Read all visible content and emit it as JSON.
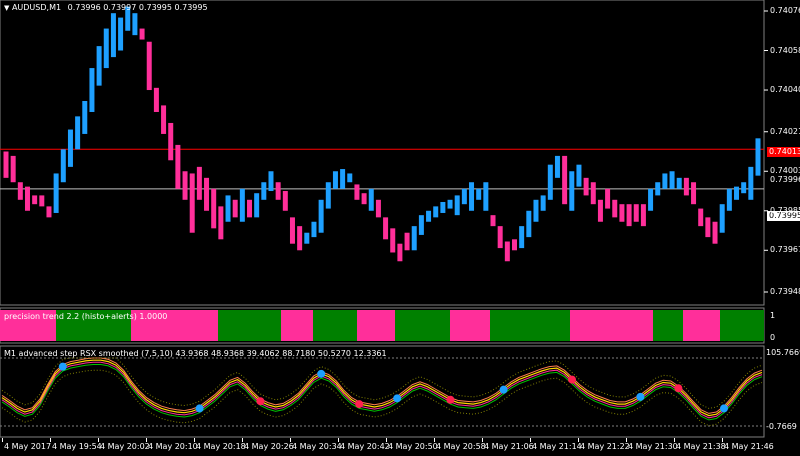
{
  "main": {
    "title": "AUDUSD,M1",
    "ohlc": "0.73996 0.73997 0.73995 0.73995",
    "price_labels": [
      "0.74076",
      "0.74058",
      "0.74040",
      "0.74021",
      "0.74003",
      "0.73985",
      "0.73967",
      "0.73948"
    ],
    "price_labels_shown": [
      "0.74076",
      "0.74058",
      "0.74040",
      "0.74021",
      "0.74003",
      "0.73985",
      "0.73967",
      "0.73948"
    ],
    "axis_prices": [
      "0.74076",
      "0.74058",
      "0.74040",
      "0.74021",
      "0.74003",
      "0.73996",
      "0.73985",
      "0.73967",
      "0.73948"
    ],
    "axis_left_labels": [
      "0.74076",
      "0.74058",
      "0.74040",
      "0.74021",
      "0.74003",
      "0.73985",
      "0.73967",
      "0.73948"
    ],
    "ask_tag": "0.74013",
    "bid_tag": "0.73995",
    "ask_color": "#ff0000",
    "bid_color": "#c0c0c0",
    "up_color": "#1ea0ff",
    "down_color": "#ff2f9a"
  },
  "axis": {
    "y_labels": [
      "0.74076",
      "0.74058",
      "0.74040",
      "0.74021",
      "0.74003",
      "0.73996",
      "0.73985",
      "0.73967",
      "0.73948"
    ]
  },
  "precision": {
    "title": "precision trend 2.2 (histo+alerts) 1.0000",
    "axis_top": "1",
    "axis_bottom": "0",
    "green": "#008000",
    "pink": "#ff2f9a",
    "segments": [
      {
        "color": "pink",
        "to": 56
      },
      {
        "color": "green",
        "to": 131
      },
      {
        "color": "pink",
        "to": 218
      },
      {
        "color": "green",
        "to": 281
      },
      {
        "color": "pink",
        "to": 313
      },
      {
        "color": "green",
        "to": 357
      },
      {
        "color": "pink",
        "to": 395
      },
      {
        "color": "green",
        "to": 450
      },
      {
        "color": "pink",
        "to": 490
      },
      {
        "color": "green",
        "to": 570
      },
      {
        "color": "pink",
        "to": 653
      },
      {
        "color": "green",
        "to": 683
      },
      {
        "color": "pink",
        "to": 720
      },
      {
        "color": "green",
        "to": 764
      }
    ]
  },
  "rsx": {
    "title": "M1 advanced step RSX smoothed (7,5,10) 43.9368 48.9368 39.4062 88.7180 50.5270 12.3361",
    "axis_top": "105.7669",
    "axis_bottom": "-0.7669"
  },
  "time_labels": [
    "4 May 2017",
    "4 May 19:54",
    "4 May 20:02",
    "4 May 20:10",
    "4 May 20:18",
    "4 May 20:26",
    "4 May 20:34",
    "4 May 20:42",
    "4 May 20:50",
    "4 May 20:58",
    "4 May 21:06",
    "4 May 21:14",
    "4 May 21:22",
    "4 May 21:30",
    "4 May 21:38",
    "4 May 21:46"
  ],
  "candles": [
    {
      "o": 0.74012,
      "c": 0.74,
      "up": false
    },
    {
      "o": 0.7401,
      "c": 0.73998,
      "up": false
    },
    {
      "o": 0.73998,
      "c": 0.7399,
      "up": false
    },
    {
      "o": 0.73996,
      "c": 0.73985,
      "up": false
    },
    {
      "o": 0.73992,
      "c": 0.73988,
      "up": false
    },
    {
      "o": 0.73992,
      "c": 0.73987,
      "up": false
    },
    {
      "o": 0.73987,
      "c": 0.73982,
      "up": false
    },
    {
      "o": 0.73984,
      "c": 0.74002,
      "up": true
    },
    {
      "o": 0.73998,
      "c": 0.74013,
      "up": true
    },
    {
      "o": 0.74005,
      "c": 0.74022,
      "up": true
    },
    {
      "o": 0.74013,
      "c": 0.74028,
      "up": true
    },
    {
      "o": 0.7402,
      "c": 0.74035,
      "up": true
    },
    {
      "o": 0.7403,
      "c": 0.7405,
      "up": true
    },
    {
      "o": 0.74042,
      "c": 0.7406,
      "up": true
    },
    {
      "o": 0.7405,
      "c": 0.74068,
      "up": true
    },
    {
      "o": 0.74055,
      "c": 0.74075,
      "up": true
    },
    {
      "o": 0.74058,
      "c": 0.74073,
      "up": true
    },
    {
      "o": 0.74067,
      "c": 0.74078,
      "up": true
    },
    {
      "o": 0.74065,
      "c": 0.74075,
      "up": true
    },
    {
      "o": 0.74068,
      "c": 0.74063,
      "up": false
    },
    {
      "o": 0.74062,
      "c": 0.7404,
      "up": false
    },
    {
      "o": 0.74041,
      "c": 0.7403,
      "up": false
    },
    {
      "o": 0.74033,
      "c": 0.7402,
      "up": false
    },
    {
      "o": 0.74025,
      "c": 0.74008,
      "up": false
    },
    {
      "o": 0.74015,
      "c": 0.73995,
      "up": false
    },
    {
      "o": 0.74003,
      "c": 0.7399,
      "up": false
    },
    {
      "o": 0.74002,
      "c": 0.73975,
      "up": false
    },
    {
      "o": 0.74005,
      "c": 0.7399,
      "up": false
    },
    {
      "o": 0.74,
      "c": 0.73985,
      "up": false
    },
    {
      "o": 0.73995,
      "c": 0.73977,
      "up": false
    },
    {
      "o": 0.73987,
      "c": 0.73972,
      "up": false
    },
    {
      "o": 0.7398,
      "c": 0.73992,
      "up": true
    },
    {
      "o": 0.7399,
      "c": 0.73982,
      "up": false
    },
    {
      "o": 0.7398,
      "c": 0.73995,
      "up": true
    },
    {
      "o": 0.7399,
      "c": 0.73982,
      "up": false
    },
    {
      "o": 0.73982,
      "c": 0.73993,
      "up": true
    },
    {
      "o": 0.7399,
      "c": 0.73998,
      "up": true
    },
    {
      "o": 0.73994,
      "c": 0.74003,
      "up": true
    },
    {
      "o": 0.73998,
      "c": 0.7399,
      "up": false
    },
    {
      "o": 0.73994,
      "c": 0.73985,
      "up": false
    },
    {
      "o": 0.73982,
      "c": 0.7397,
      "up": false
    },
    {
      "o": 0.73978,
      "c": 0.73967,
      "up": false
    },
    {
      "o": 0.7397,
      "c": 0.73975,
      "up": true
    },
    {
      "o": 0.73973,
      "c": 0.7398,
      "up": true
    },
    {
      "o": 0.73975,
      "c": 0.7399,
      "up": true
    },
    {
      "o": 0.73986,
      "c": 0.73998,
      "up": true
    },
    {
      "o": 0.73995,
      "c": 0.74003,
      "up": true
    },
    {
      "o": 0.73995,
      "c": 0.74004,
      "up": true
    },
    {
      "o": 0.73998,
      "c": 0.74002,
      "up": true
    },
    {
      "o": 0.73997,
      "c": 0.7399,
      "up": false
    },
    {
      "o": 0.73993,
      "c": 0.73988,
      "up": false
    },
    {
      "o": 0.73985,
      "c": 0.73995,
      "up": true
    },
    {
      "o": 0.7399,
      "c": 0.73982,
      "up": false
    },
    {
      "o": 0.73982,
      "c": 0.73972,
      "up": false
    },
    {
      "o": 0.73977,
      "c": 0.73966,
      "up": false
    },
    {
      "o": 0.7397,
      "c": 0.73962,
      "up": false
    },
    {
      "o": 0.73975,
      "c": 0.73967,
      "up": false
    },
    {
      "o": 0.73967,
      "c": 0.73978,
      "up": true
    },
    {
      "o": 0.73974,
      "c": 0.73983,
      "up": true
    },
    {
      "o": 0.7398,
      "c": 0.73985,
      "up": true
    },
    {
      "o": 0.73982,
      "c": 0.73987,
      "up": true
    },
    {
      "o": 0.73984,
      "c": 0.73989,
      "up": true
    },
    {
      "o": 0.73986,
      "c": 0.7399,
      "up": true
    },
    {
      "o": 0.73983,
      "c": 0.73992,
      "up": true
    },
    {
      "o": 0.73988,
      "c": 0.73995,
      "up": true
    },
    {
      "o": 0.73985,
      "c": 0.73998,
      "up": true
    },
    {
      "o": 0.7399,
      "c": 0.73995,
      "up": true
    },
    {
      "o": 0.73985,
      "c": 0.73998,
      "up": true
    },
    {
      "o": 0.73983,
      "c": 0.73978,
      "up": false
    },
    {
      "o": 0.73978,
      "c": 0.73968,
      "up": false
    },
    {
      "o": 0.73971,
      "c": 0.73962,
      "up": false
    },
    {
      "o": 0.73972,
      "c": 0.73967,
      "up": false
    },
    {
      "o": 0.73968,
      "c": 0.73978,
      "up": true
    },
    {
      "o": 0.73973,
      "c": 0.73985,
      "up": true
    },
    {
      "o": 0.7398,
      "c": 0.7399,
      "up": true
    },
    {
      "o": 0.73985,
      "c": 0.73992,
      "up": true
    },
    {
      "o": 0.7399,
      "c": 0.74006,
      "up": true
    },
    {
      "o": 0.74,
      "c": 0.7401,
      "up": true
    },
    {
      "o": 0.7401,
      "c": 0.73988,
      "up": false
    },
    {
      "o": 0.73985,
      "c": 0.74003,
      "up": true
    },
    {
      "o": 0.73996,
      "c": 0.74006,
      "up": true
    },
    {
      "o": 0.74,
      "c": 0.73992,
      "up": false
    },
    {
      "o": 0.73998,
      "c": 0.73988,
      "up": false
    },
    {
      "o": 0.7399,
      "c": 0.7398,
      "up": false
    },
    {
      "o": 0.73995,
      "c": 0.73986,
      "up": false
    },
    {
      "o": 0.7399,
      "c": 0.73982,
      "up": false
    },
    {
      "o": 0.73988,
      "c": 0.7398,
      "up": false
    },
    {
      "o": 0.73988,
      "c": 0.73978,
      "up": false
    },
    {
      "o": 0.73988,
      "c": 0.7398,
      "up": false
    },
    {
      "o": 0.73988,
      "c": 0.73978,
      "up": false
    },
    {
      "o": 0.73985,
      "c": 0.73995,
      "up": true
    },
    {
      "o": 0.73992,
      "c": 0.73998,
      "up": true
    },
    {
      "o": 0.73995,
      "c": 0.74002,
      "up": true
    },
    {
      "o": 0.73995,
      "c": 0.74003,
      "up": true
    },
    {
      "o": 0.73995,
      "c": 0.74,
      "up": true
    },
    {
      "o": 0.74,
      "c": 0.73992,
      "up": false
    },
    {
      "o": 0.73998,
      "c": 0.73988,
      "up": false
    },
    {
      "o": 0.73986,
      "c": 0.73978,
      "up": false
    },
    {
      "o": 0.73982,
      "c": 0.73973,
      "up": false
    },
    {
      "o": 0.7398,
      "c": 0.7397,
      "up": false
    },
    {
      "o": 0.73975,
      "c": 0.73988,
      "up": true
    },
    {
      "o": 0.73985,
      "c": 0.73995,
      "up": true
    },
    {
      "o": 0.7399,
      "c": 0.73996,
      "up": true
    },
    {
      "o": 0.73993,
      "c": 0.73998,
      "up": true
    },
    {
      "o": 0.7399,
      "c": 0.74005,
      "up": true
    },
    {
      "o": 0.74001,
      "c": 0.74018,
      "up": true
    }
  ]
}
